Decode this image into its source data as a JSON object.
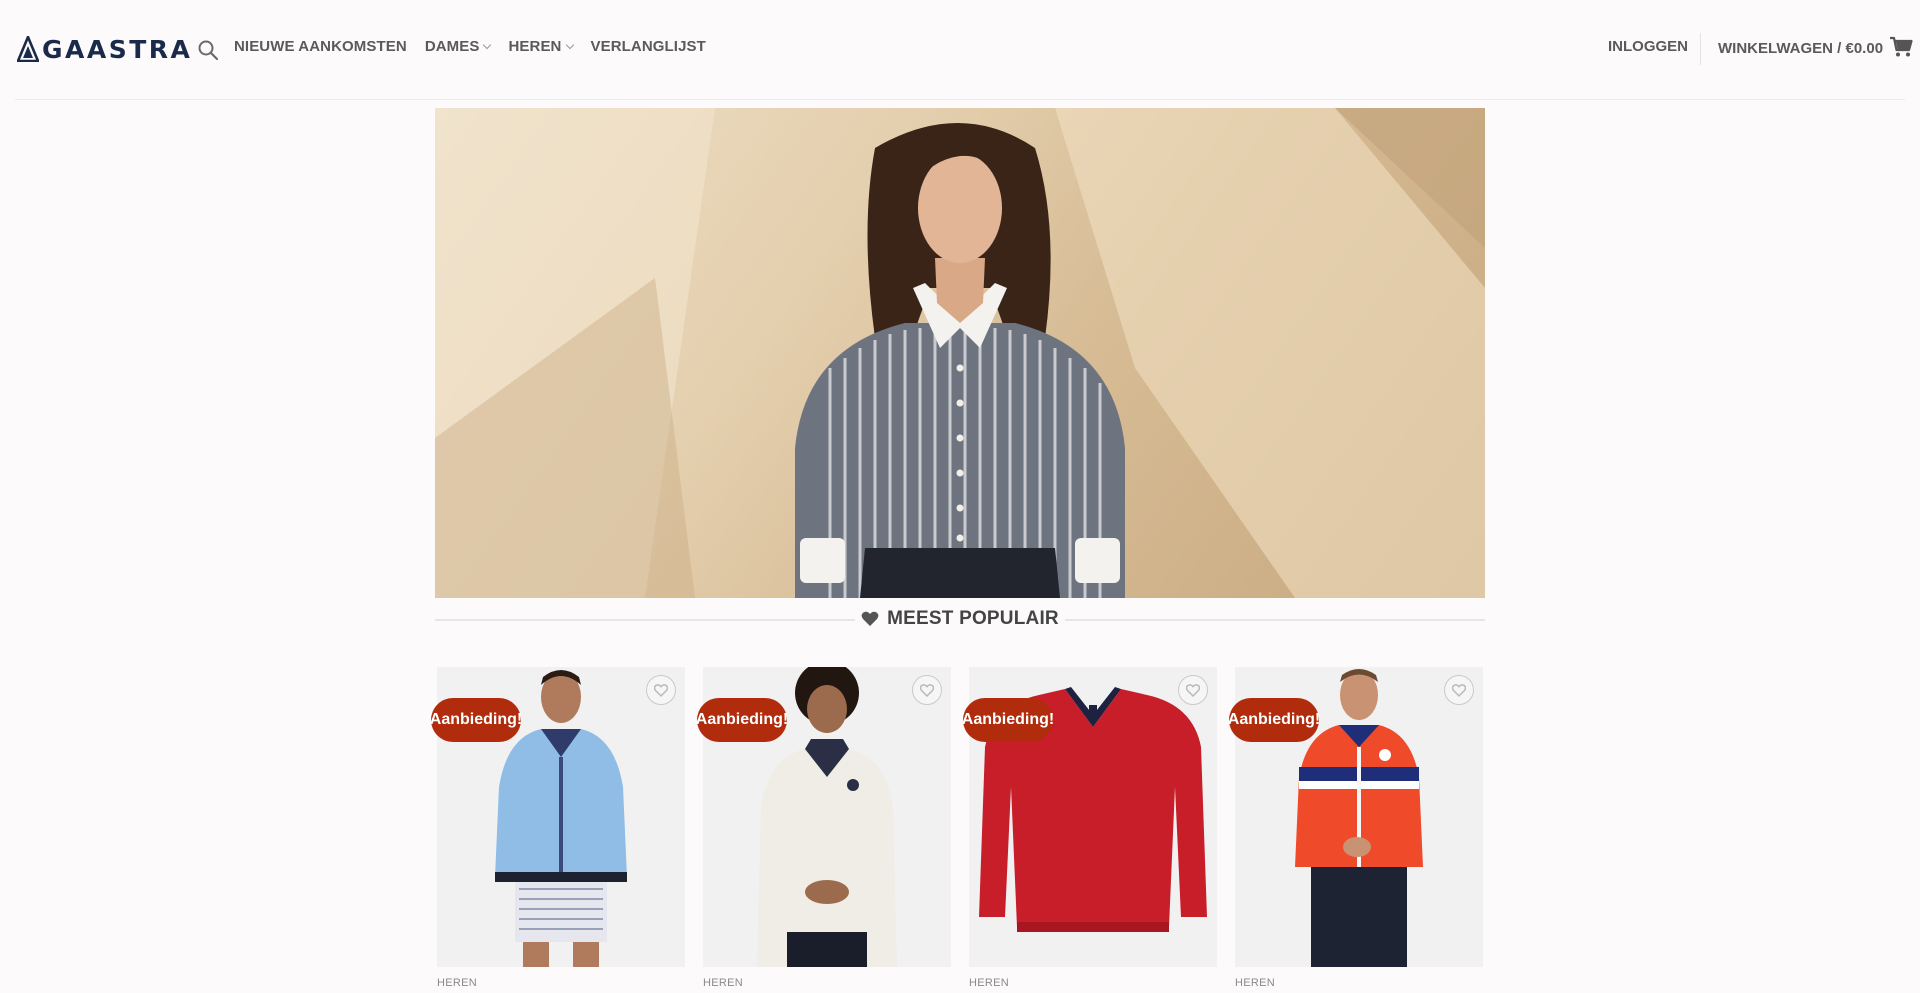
{
  "header": {
    "logo_text": "GAASTRA",
    "nav": [
      {
        "label": "NIEUWE AANKOMSTEN",
        "has_dropdown": false
      },
      {
        "label": "DAMES",
        "has_dropdown": true
      },
      {
        "label": "HEREN",
        "has_dropdown": true
      },
      {
        "label": "VERLANGLIJST",
        "has_dropdown": false
      }
    ],
    "login_label": "INLOGGEN",
    "cart_label": "WINKELWAGEN / €0.00"
  },
  "section": {
    "title": "MEEST POPULAIR"
  },
  "products": [
    {
      "badge": "Aanbieding!",
      "category": "HEREN",
      "garment_color": "#8fbde6"
    },
    {
      "badge": "Aanbieding!",
      "category": "HEREN",
      "garment_color": "#efede6"
    },
    {
      "badge": "Aanbieding!",
      "category": "HEREN",
      "garment_color": "#c81e2a"
    },
    {
      "badge": "Aanbieding!",
      "category": "HEREN",
      "garment_color": "#ef4a2a"
    }
  ],
  "colors": {
    "brand": "#1b2a4a",
    "badge": "#b02c0d",
    "nav_text": "#5a5a5a"
  }
}
